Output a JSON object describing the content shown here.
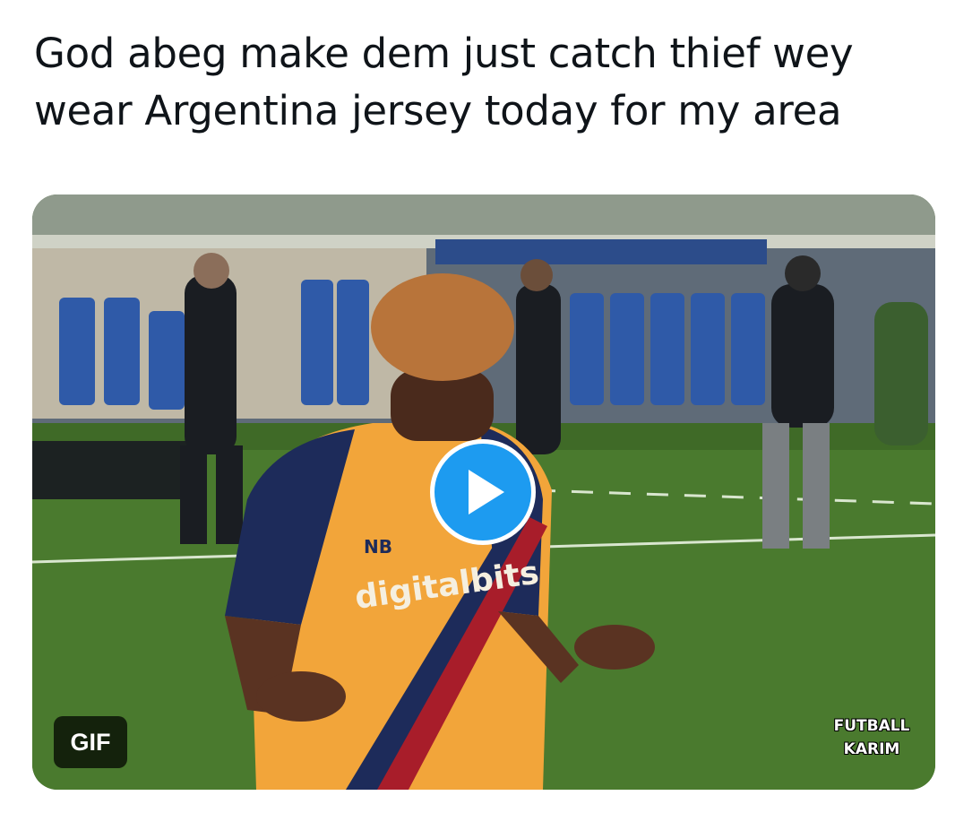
{
  "tweet": {
    "text": "God abeg make dem just catch thief wey wear Argentina jersey today for my area"
  },
  "media": {
    "badge_label": "GIF",
    "play_icon": "play-icon",
    "watermark_line1": "FUTBALL",
    "watermark_line2": "KARIM",
    "jersey_sponsor": "digitalbits",
    "jersey_brand": "NB",
    "colors": {
      "play_button": "#1d9bf0",
      "pitch": "#4a7a2e",
      "jersey_orange": "#f2a53a",
      "jersey_navy": "#1d2b5a",
      "jersey_red": "#a81d2a"
    }
  }
}
